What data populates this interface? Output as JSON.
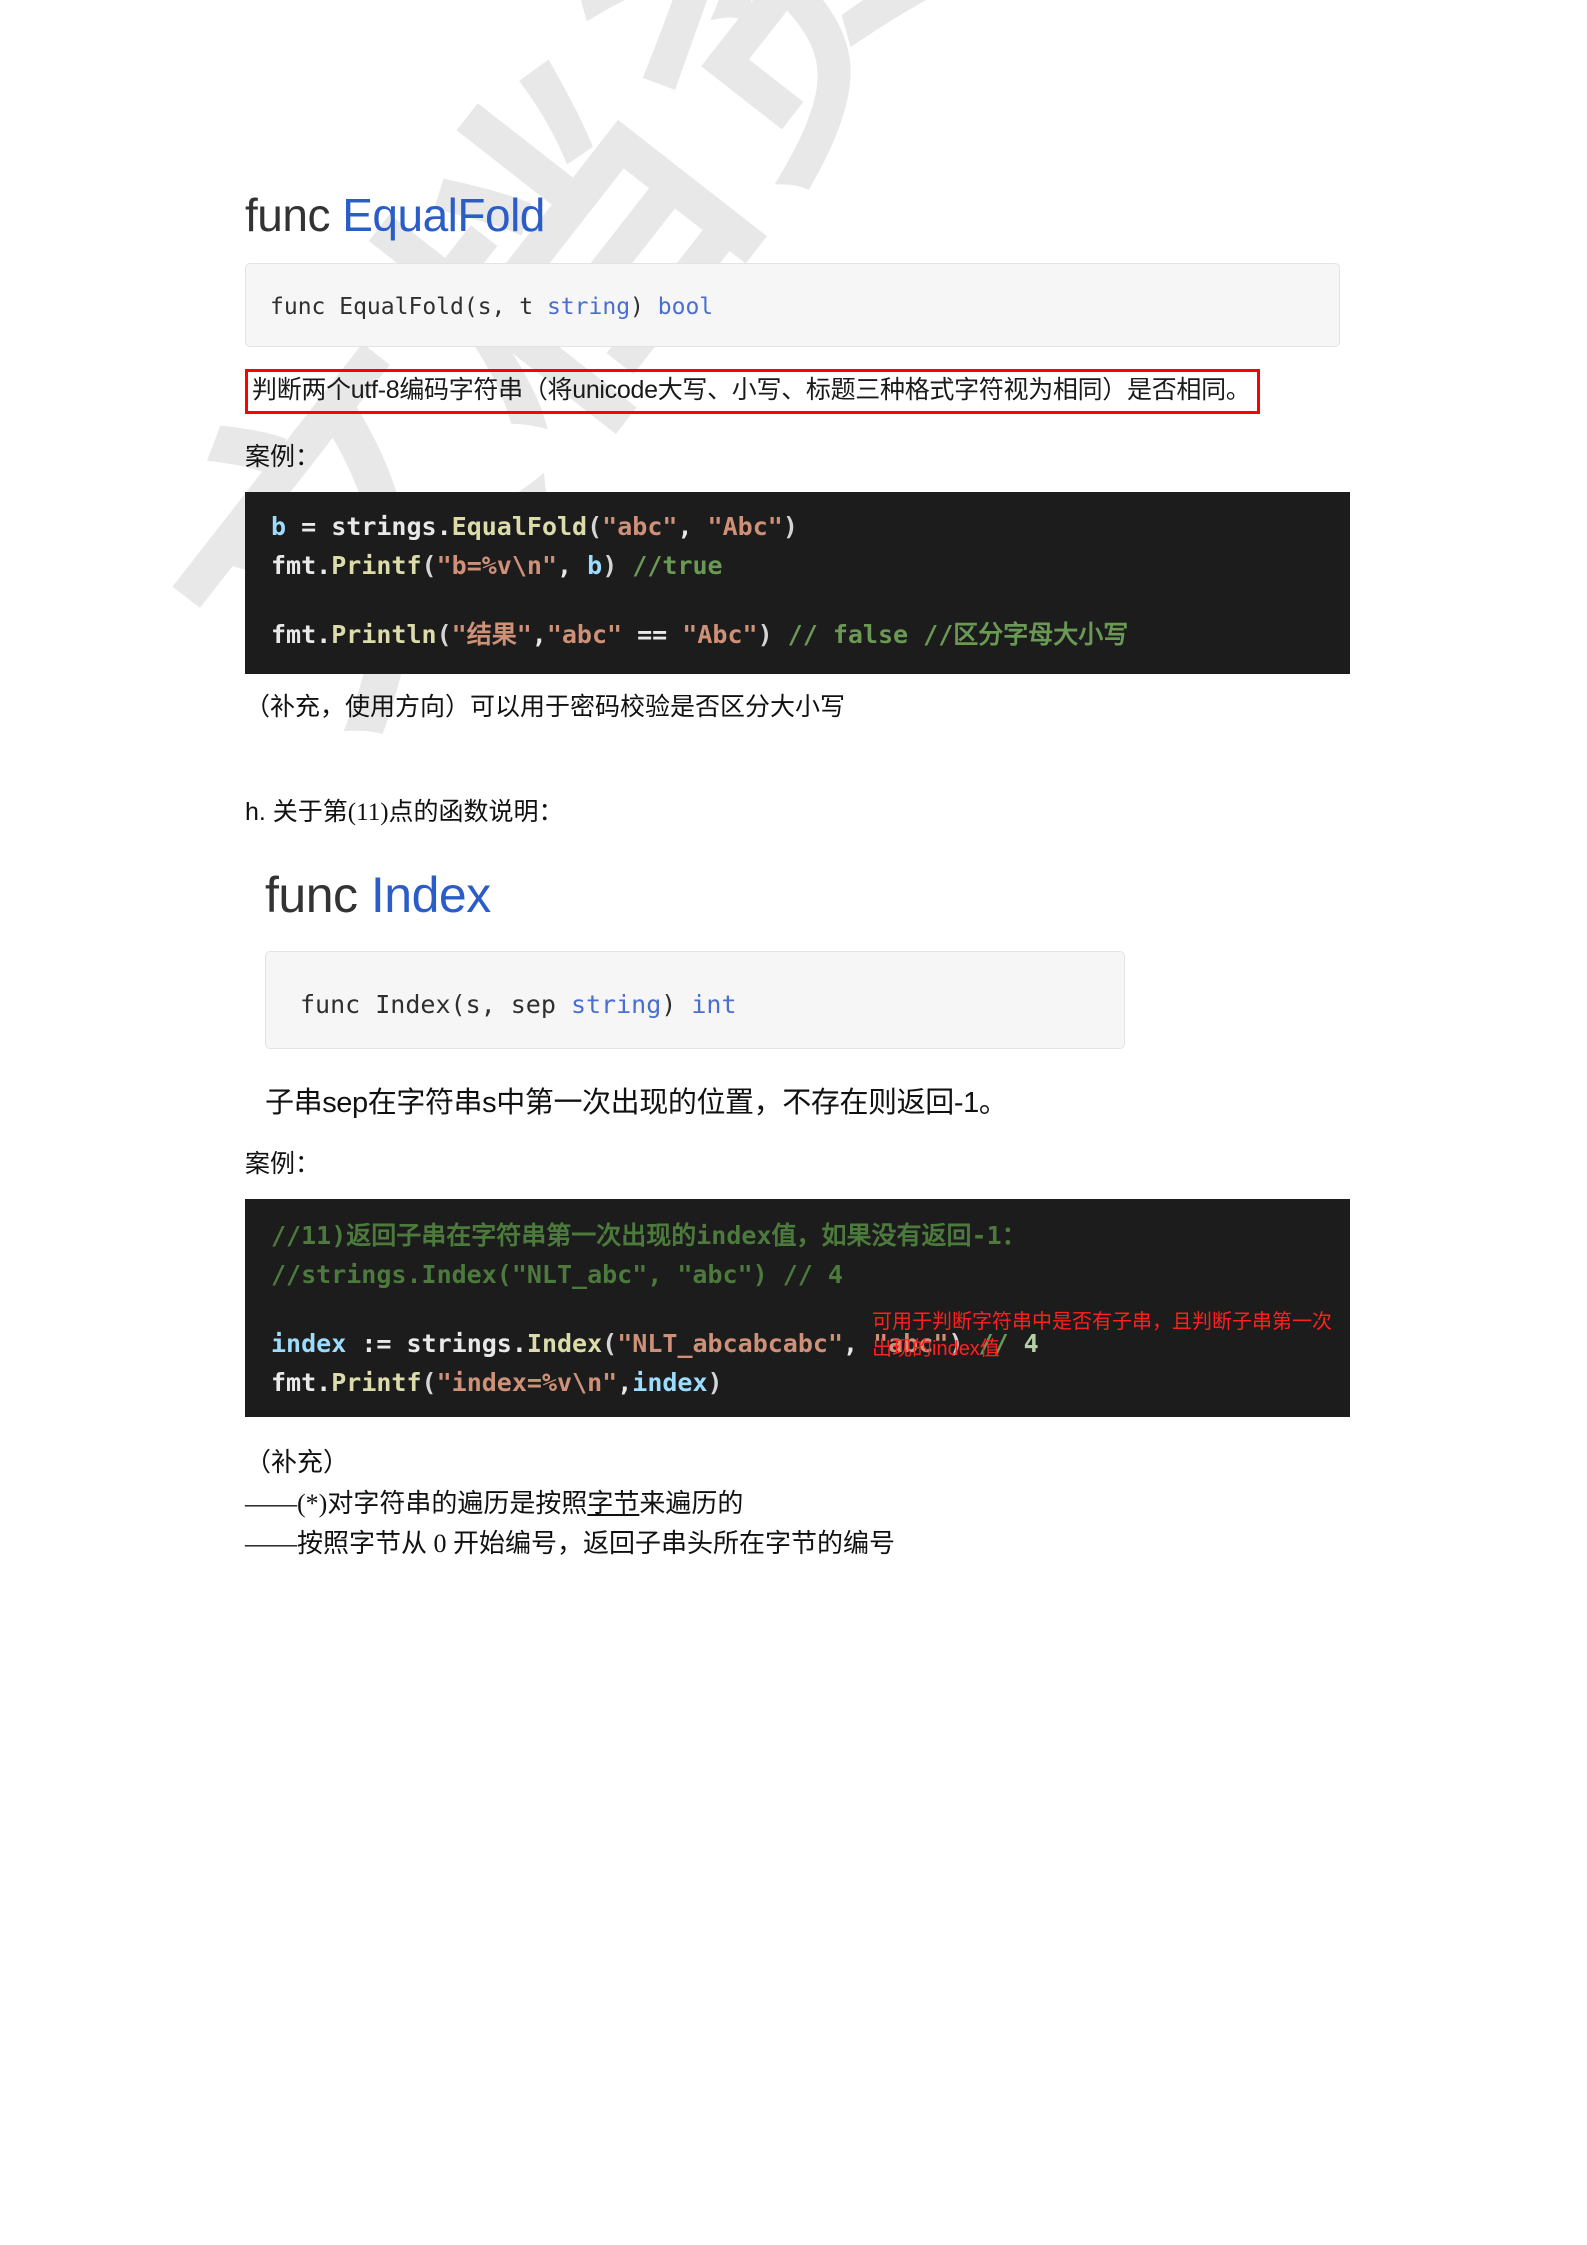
{
  "watermark": {
    "text": "文档资料"
  },
  "section_equalfold": {
    "heading_prefix": "func ",
    "heading_name": "EqualFold",
    "signature": {
      "part1": "func EqualFold(s, t ",
      "type1": "string",
      "part2": ") ",
      "type2": "bool"
    },
    "description_boxed": "判断两个utf-8编码字符串（将unicode大写、小写、标题三种格式字符视为相同）是否相同。",
    "example_label": "案例：",
    "code": {
      "line1": {
        "var": "b",
        "eq": " = ",
        "pkg": "strings.",
        "func": "EqualFold",
        "open": "(",
        "arg1": "\"abc\"",
        "comma": ", ",
        "arg2": "\"Abc\"",
        "close": ")"
      },
      "line2": {
        "pkg": "fmt.",
        "func": "Printf",
        "open": "(",
        "arg1": "\"b=%v\\n\"",
        "comma": ", ",
        "arg2": "b",
        "close": ")",
        "comment": " //true"
      },
      "line3": {
        "pkg": "fmt.",
        "func": "Println",
        "open": "(",
        "arg1": "\"结果\"",
        "comma": ",",
        "arg2": "\"abc\"",
        "op": " == ",
        "arg3": "\"Abc\"",
        "close": ")",
        "comment1": " // false ",
        "comment2": "//区分字母大小写"
      }
    },
    "supplement": "（补充，使用方向）可以用于密码校验是否区分大小写"
  },
  "section_index": {
    "intro_marker": "h. ",
    "intro_text": "关于第(11)点的函数说明：",
    "heading_prefix": "func ",
    "heading_name": "Index",
    "signature": {
      "part1": "func Index(s, sep ",
      "type1": "string",
      "part2": ") ",
      "type2": "int"
    },
    "description": "子串sep在字符串s中第一次出现的位置，不存在则返回-1。",
    "example_label": "案例：",
    "code": {
      "comment1": "//11)返回子串在字符串第一次出现的index值，如果没有返回-1：",
      "comment2": "//strings.Index(\"NLT_abc\", \"abc\") // 4",
      "line1": {
        "var": "index",
        "assign": " := ",
        "pkg": "strings.",
        "func": "Index",
        "open": "(",
        "arg1": "\"NLT_abcabcabc\"",
        "comma": ", ",
        "arg2": "\"abc\"",
        "close": ")",
        "comment": " // ",
        "num": "4"
      },
      "line2": {
        "pkg": "fmt.",
        "func": "Printf",
        "open": "(",
        "arg1": "\"index=%v\\n\"",
        "comma": ",",
        "arg2": "index",
        "close": ")"
      },
      "annotation": "可用于判断字符串中是否有子串，且判断子串第一次出现的index值"
    },
    "supplement_title": "（补充）",
    "supplement_line1_pre": "——(*)对字符串的遍历是按照",
    "supplement_line1_underline": "字节",
    "supplement_line1_post": "来遍历的",
    "supplement_line2": "——按照字节从 0 开始编号，返回子串头所在字节的编号"
  },
  "colors": {
    "heading_link": "#2b5dc9",
    "red_border": "#ff0000",
    "red_annotation": "#ff2020",
    "code_bg": "#1c1c1c",
    "sig_bg": "#f6f6f6"
  }
}
